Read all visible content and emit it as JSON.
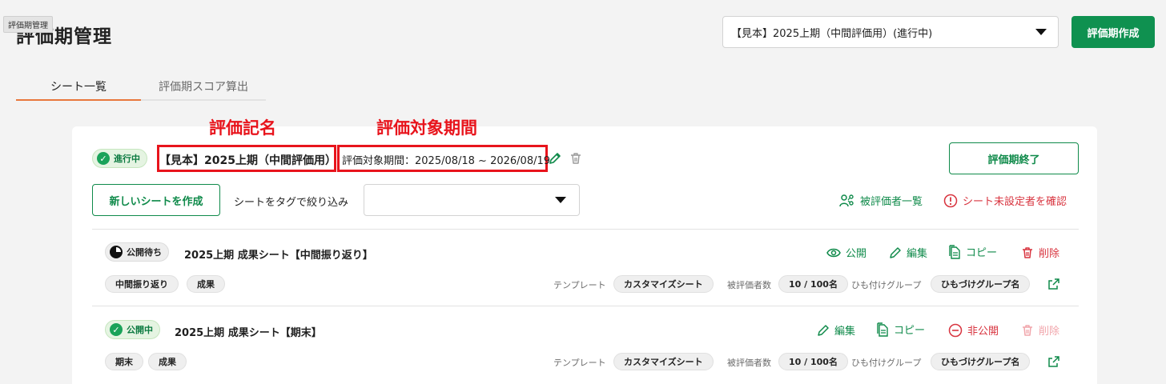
{
  "tooltip": "評価期管理",
  "page_title": "評価期管理",
  "period_select": {
    "value": "【見本】2025上期（中間評価用）(進行中)"
  },
  "create_period_button": "評価期作成",
  "tabs": [
    {
      "label": "シート一覧"
    },
    {
      "label": "評価期スコア算出"
    }
  ],
  "annotations": {
    "name_label": "評価記名",
    "period_label": "評価対象期間",
    "color": "#e8141c"
  },
  "period": {
    "status": "進行中",
    "name": "【見本】2025上期（中間評価用）",
    "range": "評価対象期間：2025/08/18 ~ 2026/08/19",
    "end_button": "評価期終了"
  },
  "toolbar": {
    "new_sheet_button": "新しいシートを作成",
    "filter_label": "シートをタグで絞り込み",
    "evaluatees_link": "被評価者一覧",
    "unset_link": "シート未設定者を確認"
  },
  "labels": {
    "template": "テンプレート",
    "evaluatee_count": "被評価者数",
    "linked_group": "ひも付けグループ"
  },
  "sheets": [
    {
      "status": "公開待ち",
      "title": "2025上期 成果シート【中間振り返り】",
      "actions": [
        "公開",
        "編集",
        "コピー",
        "削除"
      ],
      "tags": [
        "中間振り返り",
        "成果"
      ],
      "template": "カスタマイズシート",
      "count": "10 / 100名",
      "group": "ひもづけグループ名"
    },
    {
      "status": "公開中",
      "title": "2025上期 成果シート【期末】",
      "actions": [
        "編集",
        "コピー",
        "非公開",
        "削除"
      ],
      "tags": [
        "期末",
        "成果"
      ],
      "template": "カスタマイズシート",
      "count": "10 / 100名",
      "group": "ひもづけグループ名"
    }
  ],
  "colors": {
    "brand_green": "#0f9150",
    "tab_accent": "#e8783c",
    "danger": "#d8343f"
  }
}
